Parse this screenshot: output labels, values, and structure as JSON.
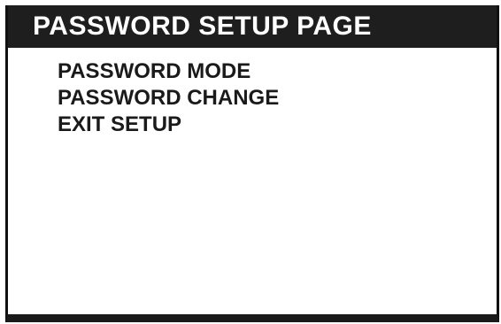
{
  "window": {
    "title": "PASSWORD SETUP PAGE"
  },
  "menu": {
    "items": [
      {
        "label": "PASSWORD MODE"
      },
      {
        "label": "PASSWORD CHANGE"
      },
      {
        "label": "EXIT SETUP"
      }
    ]
  },
  "colors": {
    "title_bar_background": "#1e1e1e",
    "title_text": "#ffffff",
    "menu_text": "#1a1a1a",
    "screen_background": "#ffffff"
  }
}
